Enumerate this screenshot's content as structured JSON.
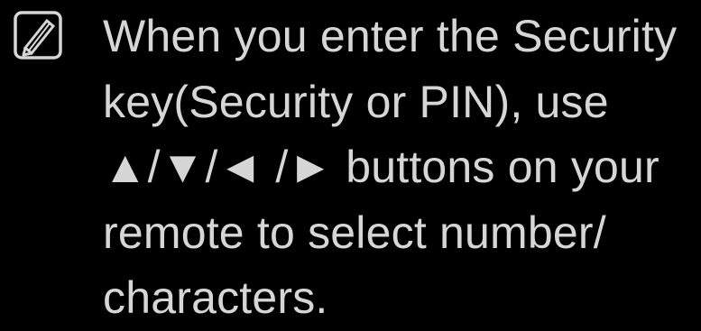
{
  "note": {
    "icon": "note-pencil-icon",
    "lines": [
      "When you enter the Security",
      "key(Security or PIN), use",
      "▲/▼/◄ /► buttons on your",
      "remote to select number/",
      "characters."
    ]
  },
  "colors": {
    "background": "#000000",
    "text": "#d6d6d6",
    "icon": "#d6d6d6"
  }
}
